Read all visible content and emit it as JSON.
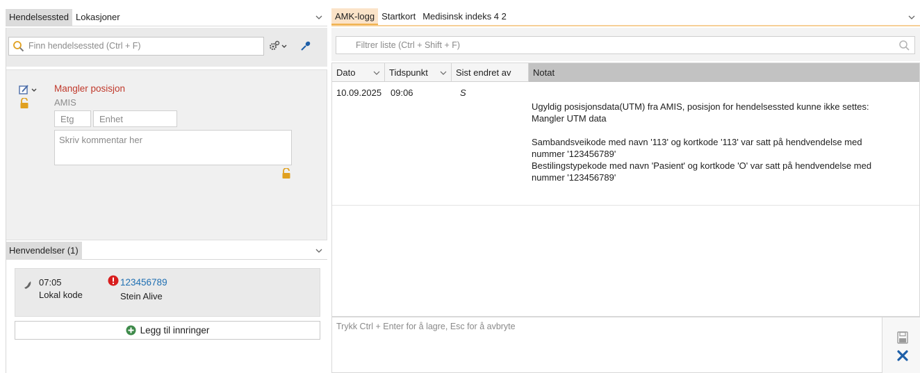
{
  "left": {
    "tabs": [
      {
        "label": "Hendelsessted",
        "active": true
      },
      {
        "label": "Lokasjoner",
        "active": false
      }
    ],
    "search": {
      "placeholder": "Finn hendelsessted (Ctrl + F)"
    },
    "location": {
      "status": "Mangler posisjon",
      "source": "AMIS",
      "etg_placeholder": "Etg",
      "enhet_placeholder": "Enhet",
      "comment_placeholder": "Skriv kommentar her"
    },
    "henvendelser": {
      "tab_label": "Henvendelser (1)",
      "call": {
        "time": "07:05",
        "code": "Lokal kode",
        "number": "123456789",
        "name": "Stein Alive"
      },
      "add_button": "Legg til innringer"
    }
  },
  "right": {
    "tabs": [
      {
        "label": "AMK-logg",
        "active": true
      },
      {
        "label": "Startkort",
        "active": false
      },
      {
        "label": "Medisinsk indeks 4 2",
        "active": false
      }
    ],
    "filter": {
      "placeholder": "Filtrer liste (Ctrl + Shift + F)"
    },
    "grid": {
      "columns": [
        "Dato",
        "Tidspunkt",
        "Sist endret av",
        "Notat"
      ],
      "rows": [
        {
          "dato": "10.09.2025",
          "tid": "09:06",
          "endret_av": "S",
          "notat_lines": [
            "Ugyldig posisjonsdata(UTM) fra AMIS, posisjon for hendelsessted kunne ikke settes:",
            "Mangler UTM data",
            "",
            "Sambandsveikode med navn '113' og kortkode '113' var satt på hendvendelse med",
            "nummer '123456789'",
            "Bestilingstypekode med navn 'Pasient' og kortkode 'O' var satt på hendvendelse med",
            "nummer '123456789'"
          ]
        }
      ]
    },
    "input": {
      "placeholder": "Trykk Ctrl + Enter for å lagre, Esc for å avbryte"
    }
  },
  "colors": {
    "accent_orange": "#f0b24e",
    "link_blue": "#1f6fb2",
    "error_red": "#c0392b",
    "lock_amber": "#e0a020",
    "cancel_blue": "#1e5fa8"
  }
}
